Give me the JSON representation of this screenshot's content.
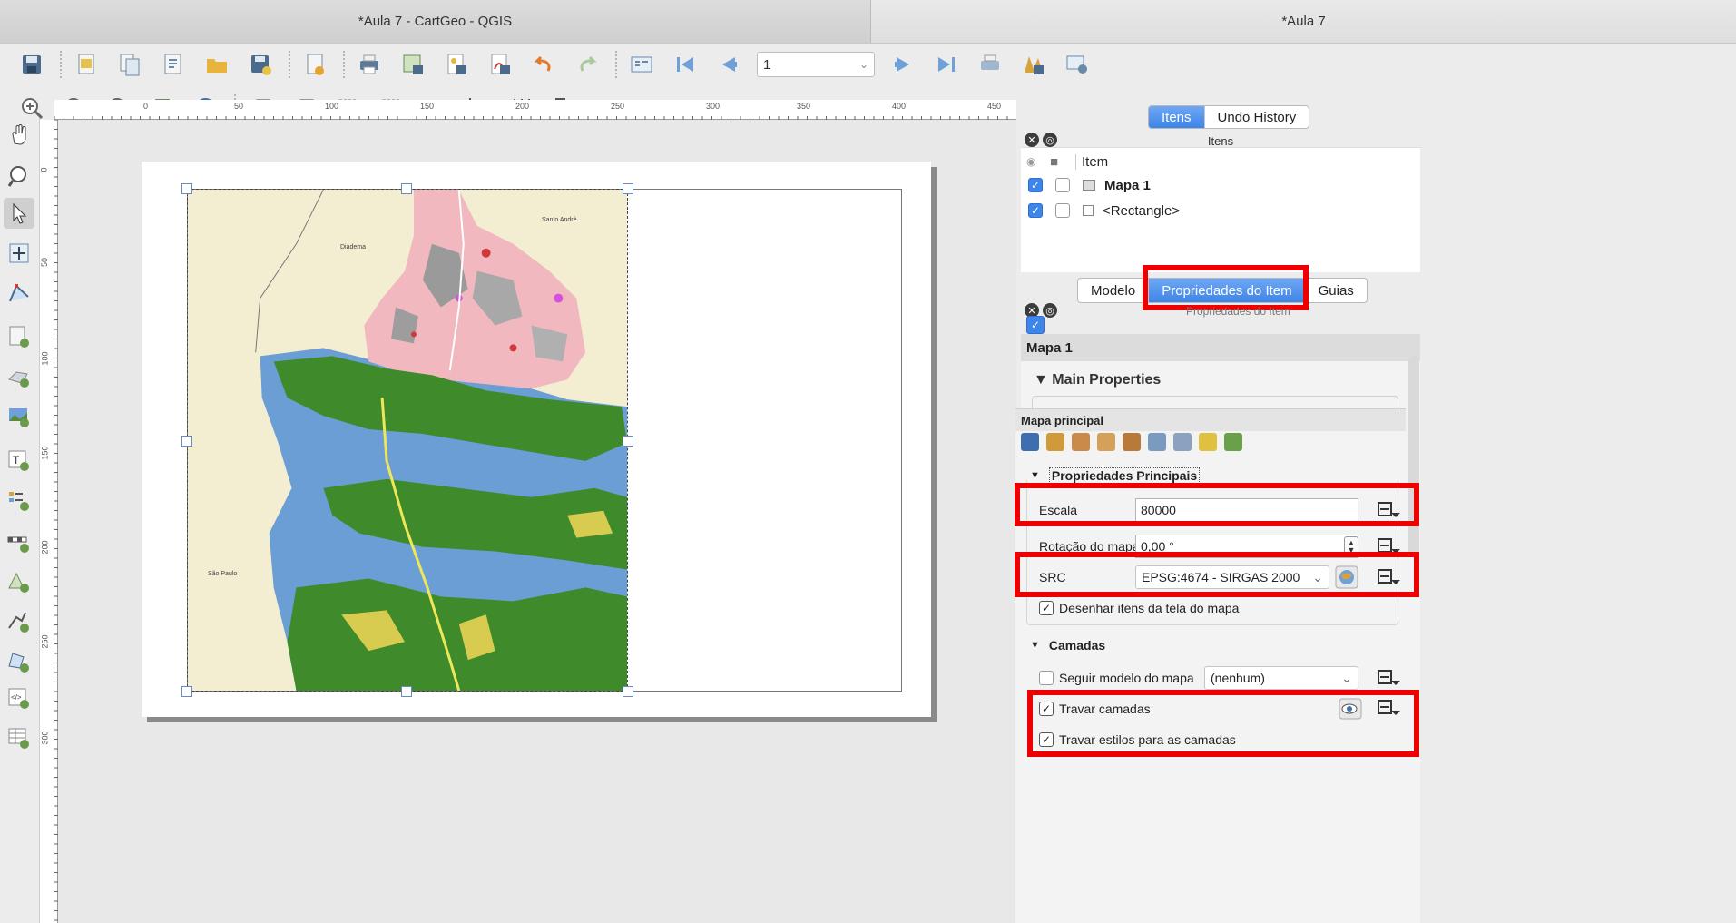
{
  "window": {
    "active_tab": "*Aula 7 - CartGeo - QGIS",
    "inactive_tab": "*Aula 7"
  },
  "toolbar": {
    "page_number": "1"
  },
  "ruler": {
    "h_ticks": [
      "0",
      "50",
      "100",
      "150",
      "200",
      "250",
      "300",
      "350",
      "400",
      "450"
    ],
    "v_ticks": [
      "0",
      "50",
      "100",
      "150",
      "200",
      "250",
      "300"
    ]
  },
  "map": {
    "labels": [
      "Santo André",
      "Diadema",
      "São Paulo"
    ]
  },
  "items_panel": {
    "tabs": [
      "Itens",
      "Undo History"
    ],
    "active_tab": "Itens",
    "title": "Itens",
    "column_header": "Item",
    "items": [
      {
        "label": "Mapa 1",
        "visible": true,
        "locked": false,
        "bold": true
      },
      {
        "label": "<Rectangle>",
        "visible": true,
        "locked": false,
        "bold": false
      }
    ]
  },
  "props_panel": {
    "tabs": [
      "Modelo",
      "Propriedades do Item",
      "Guias"
    ],
    "active_tab": "Propriedades do Item",
    "title_partial": "Propriedades do Item",
    "item_name": "Mapa 1",
    "main_properties_label": "Main Properties"
  },
  "map_panel": {
    "header": "Mapa principal",
    "section_main": "Propriedades Principais",
    "scale_label": "Escala",
    "scale_value": "80000",
    "rotation_label": "Rotação do mapa",
    "rotation_value": "0,00 °",
    "crs_label": "SRC",
    "crs_value": "EPSG:4674 - SIRGAS 2000",
    "draw_items_label": "Desenhar itens da tela do mapa",
    "draw_items_checked": true,
    "section_layers": "Camadas",
    "follow_theme_label": "Seguir modelo do mapa",
    "follow_theme_checked": false,
    "theme_value": "(nenhum)",
    "lock_layers_label": "Travar camadas",
    "lock_layers_checked": true,
    "lock_styles_label": "Travar estilos para as camadas",
    "lock_styles_checked": true
  },
  "colors": {
    "highlight": "#ee0000",
    "accent": "#3d85e8",
    "water": "#6a9ed4",
    "vegetation": "#3f8a2a",
    "urban": "#f2b8c0",
    "land": "#f3eed2"
  }
}
